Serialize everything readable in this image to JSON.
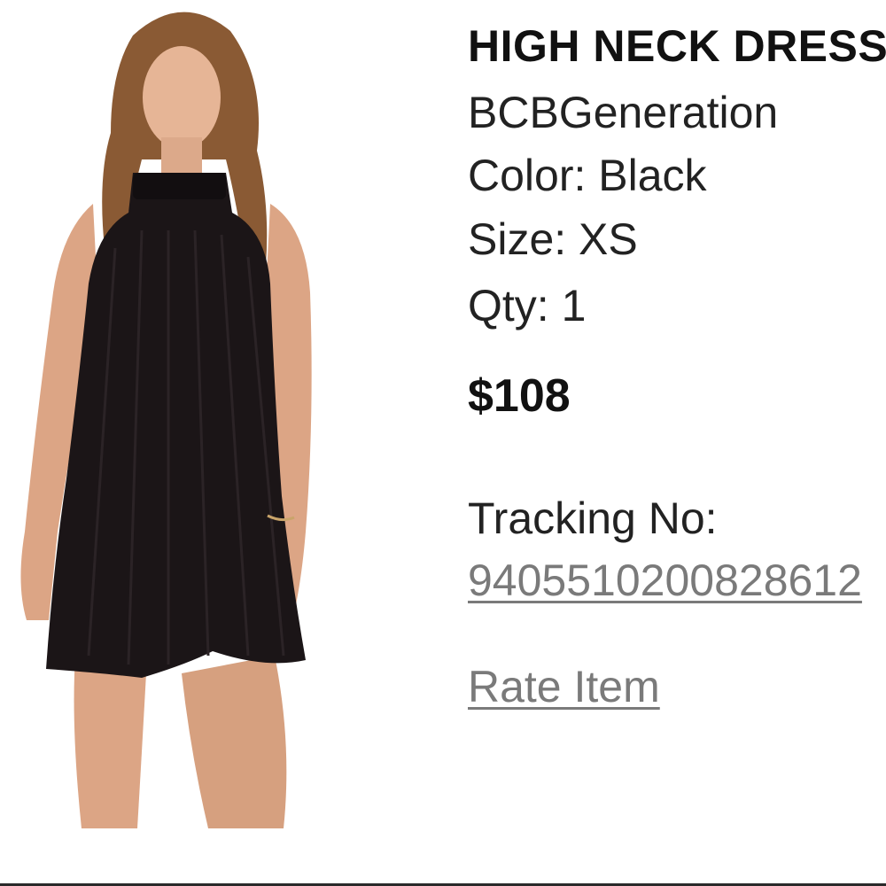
{
  "product": {
    "title": "HIGH NECK DRESS",
    "brand": "BCBGeneration",
    "color": "Color: Black",
    "size": "Size: XS",
    "qty": "Qty: 1",
    "price": "$108",
    "image_icon": "dress-photo"
  },
  "tracking": {
    "label": "Tracking No:",
    "number": "9405510200828612"
  },
  "actions": {
    "rate_item": "Rate Item"
  },
  "colors": {
    "link": "#7a7a7a",
    "text": "#222222",
    "divider": "#2a2a2a"
  }
}
